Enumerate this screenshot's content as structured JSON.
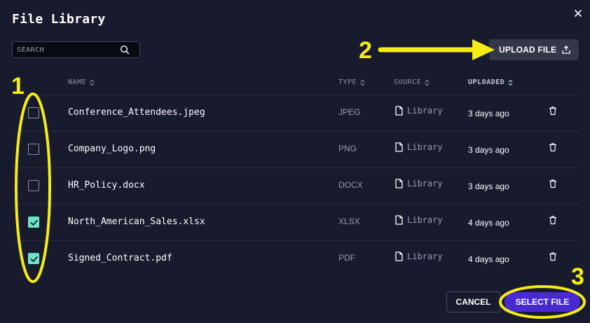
{
  "dialog": {
    "title": "File Library"
  },
  "search": {
    "placeholder": "SEARCH",
    "value": ""
  },
  "upload_label": "UPLOAD FILE",
  "columns": {
    "name": "NAME",
    "type": "TYPE",
    "source": "SOURCE",
    "uploaded": "UPLOADED"
  },
  "files": [
    {
      "name": "Conference_Attendees.jpeg",
      "type": "JPEG",
      "source": "Library",
      "uploaded": "3 days ago",
      "checked": false
    },
    {
      "name": "Company_Logo.png",
      "type": "PNG",
      "source": "Library",
      "uploaded": "3 days ago",
      "checked": false
    },
    {
      "name": "HR_Policy.docx",
      "type": "DOCX",
      "source": "Library",
      "uploaded": "3 days ago",
      "checked": false
    },
    {
      "name": "North_American_Sales.xlsx",
      "type": "XLSX",
      "source": "Library",
      "uploaded": "4 days ago",
      "checked": true
    },
    {
      "name": "Signed_Contract.pdf",
      "type": "PDF",
      "source": "Library",
      "uploaded": "4 days ago",
      "checked": true
    }
  ],
  "footer": {
    "cancel_label": "CANCEL",
    "select_label": "SELECT FILE"
  },
  "annotations": {
    "n1": "1",
    "n2": "2",
    "n3": "3"
  },
  "colors": {
    "background": "#181a2e",
    "checkbox_checked": "#6fe3c7",
    "primary_button": "#4a2ad0",
    "annotation": "#f6ec13"
  }
}
